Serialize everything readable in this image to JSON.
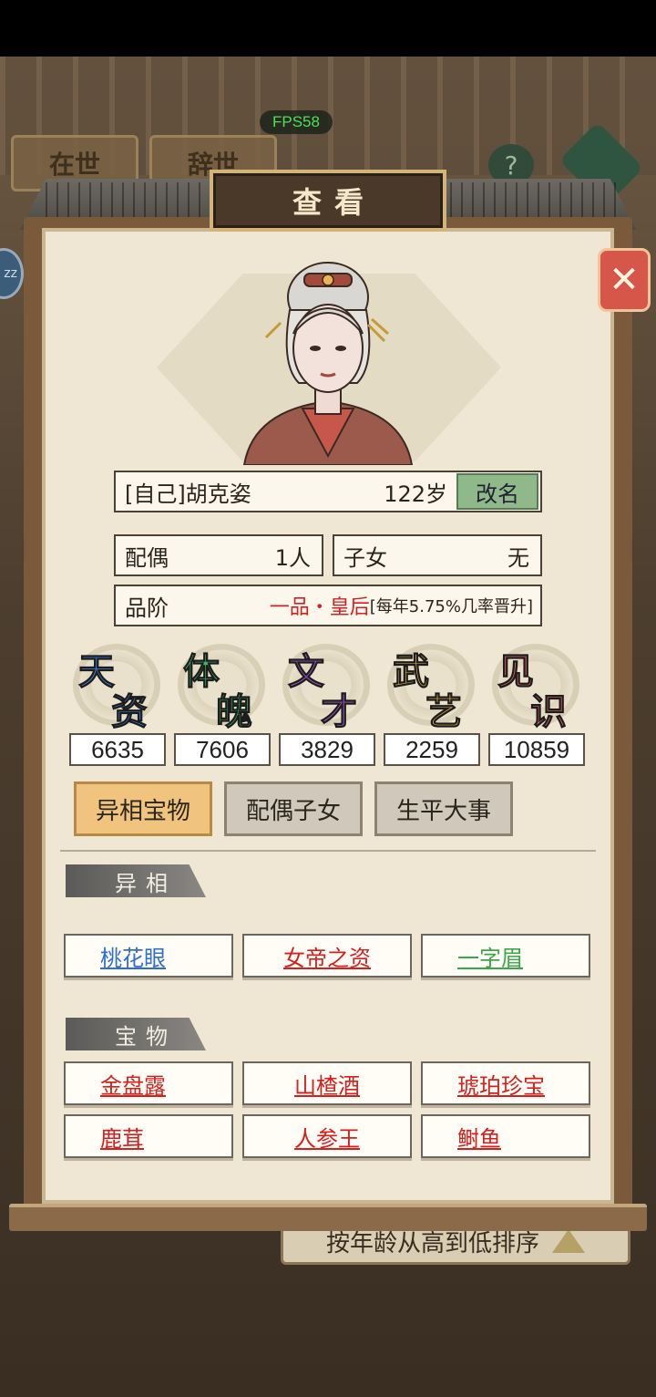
{
  "fps": "FPS58",
  "background": {
    "tabs": [
      "在世",
      "辞世"
    ],
    "help_label": "?",
    "sort_label": "按年龄从高到低排序"
  },
  "modal": {
    "title": "查看",
    "close_icon": "close-x-icon"
  },
  "person": {
    "name": "[自己]胡克姿",
    "age": "122岁",
    "rename_label": "改名",
    "spouse_label": "配偶",
    "spouse_value": "1人",
    "children_label": "子女",
    "children_value": "无",
    "rank_label": "品阶",
    "rank_value": "一品・皇后",
    "rank_note": "[每年5.75%几率晋升]"
  },
  "stats": [
    {
      "c1": "天",
      "c2": "资",
      "value": "6635",
      "color": "#3d7fd6"
    },
    {
      "c1": "体",
      "c2": "魄",
      "value": "7606",
      "color": "#3fb36b"
    },
    {
      "c1": "文",
      "c2": "才",
      "value": "3829",
      "color": "#a454c8"
    },
    {
      "c1": "武",
      "c2": "艺",
      "value": "2259",
      "color": "#e0a84a"
    },
    {
      "c1": "见",
      "c2": "识",
      "value": "10859",
      "color": "#e06060"
    }
  ],
  "tabs": [
    {
      "label": "异相宝物",
      "active": true
    },
    {
      "label": "配偶子女",
      "active": false
    },
    {
      "label": "生平大事",
      "active": false
    }
  ],
  "traits": {
    "label": "异相",
    "items": [
      {
        "text": "桃花眼",
        "color": "#2f6fd1"
      },
      {
        "text": "女帝之资",
        "color": "#d52020"
      },
      {
        "text": "一字眉",
        "color": "#3aa84a"
      }
    ]
  },
  "treasures": {
    "label": "宝物",
    "items": [
      {
        "text": "金盘露",
        "color": "#d52020"
      },
      {
        "text": "山楂酒",
        "color": "#d52020"
      },
      {
        "text": "琥珀珍宝",
        "color": "#d52020"
      },
      {
        "text": "鹿茸",
        "color": "#d52020"
      },
      {
        "text": "人参王",
        "color": "#d52020"
      },
      {
        "text": "鲥鱼",
        "color": "#d52020"
      }
    ]
  }
}
